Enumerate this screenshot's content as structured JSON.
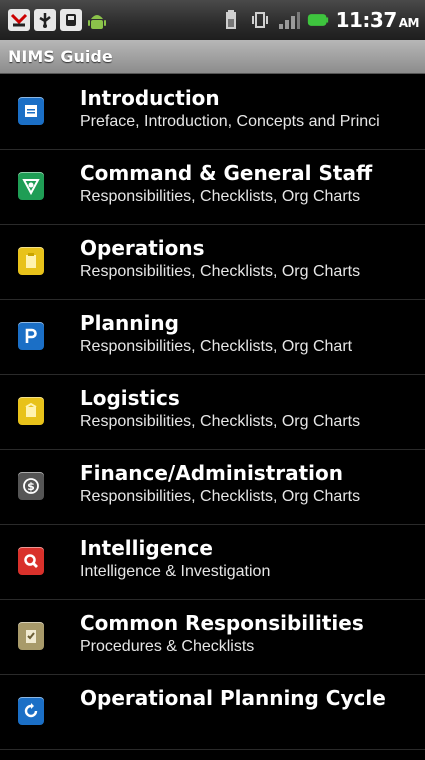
{
  "status_bar": {
    "time": "11:37",
    "ampm": "AM",
    "icons": [
      "missed-call-icon",
      "usb-icon",
      "sd-card-icon",
      "android-icon",
      "battery-icon",
      "vibrate-icon",
      "signal-icon",
      "battery-full-icon"
    ]
  },
  "app": {
    "title": "NIMS Guide"
  },
  "menu": {
    "items": [
      {
        "title": "Introduction",
        "subtitle": "Preface, Introduction, Concepts and Princi",
        "icon": "document-icon",
        "color": "#1b6fc6"
      },
      {
        "title": "Command & General Staff",
        "subtitle": "Responsibilities, Checklists, Org Charts",
        "icon": "shield-icon",
        "color": "#1f9d55"
      },
      {
        "title": "Operations",
        "subtitle": "Responsibilities, Checklists, Org Charts",
        "icon": "clipboard-icon",
        "color": "#e8c21a"
      },
      {
        "title": "Planning",
        "subtitle": "Responsibilities, Checklists, Org Chart",
        "icon": "letter-p-icon",
        "color": "#1b6fc6"
      },
      {
        "title": "Logistics",
        "subtitle": "Responsibilities, Checklists, Org Charts",
        "icon": "box-icon",
        "color": "#e8c21a"
      },
      {
        "title": "Finance/Administration",
        "subtitle": "Responsibilities, Checklists, Org Charts",
        "icon": "dollar-icon",
        "color": "#555555"
      },
      {
        "title": "Intelligence",
        "subtitle": "Intelligence & Investigation",
        "icon": "magnifier-icon",
        "color": "#d9312b"
      },
      {
        "title": "Common Responsibilities",
        "subtitle": "Procedures & Checklists",
        "icon": "checklist-icon",
        "color": "#a89a6a"
      },
      {
        "title": "Operational Planning Cycle",
        "subtitle": "",
        "icon": "cycle-icon",
        "color": "#1b6fc6"
      }
    ]
  }
}
